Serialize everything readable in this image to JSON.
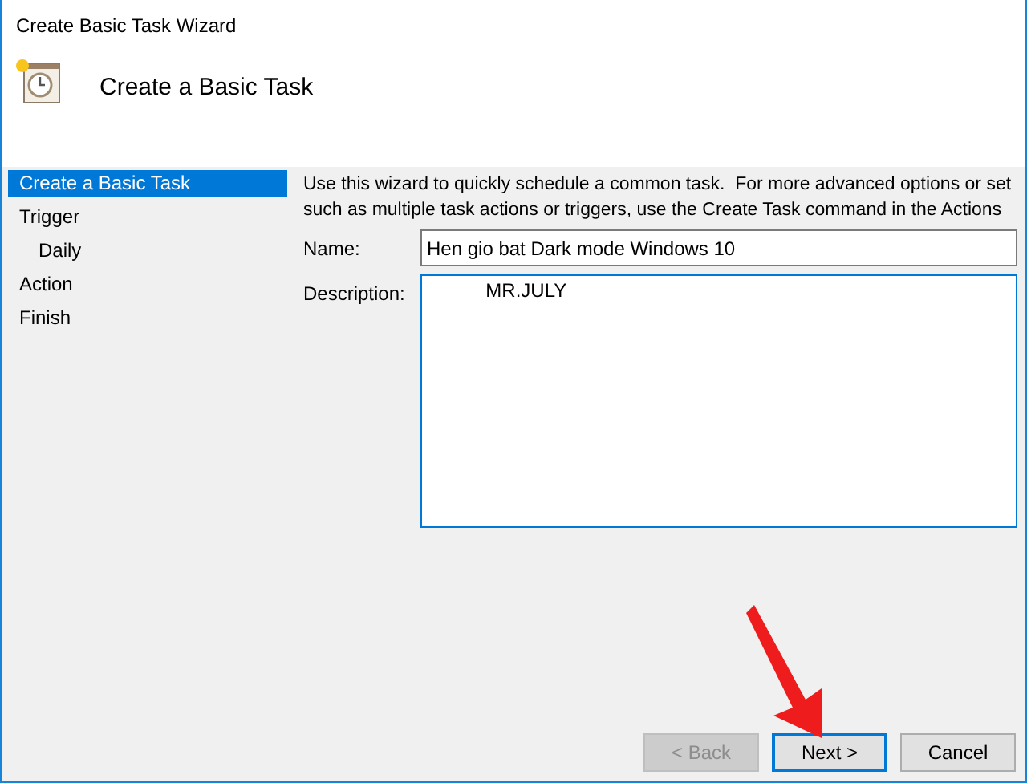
{
  "window": {
    "title": "Create Basic Task Wizard"
  },
  "header": {
    "title": "Create a Basic Task"
  },
  "steps": [
    {
      "label": "Create a Basic Task",
      "selected": true
    },
    {
      "label": "Trigger",
      "selected": false,
      "children": [
        {
          "label": "Daily",
          "selected": false
        }
      ]
    },
    {
      "label": "Action",
      "selected": false
    },
    {
      "label": "Finish",
      "selected": false
    }
  ],
  "intro": [
    "Use this wizard to quickly schedule a common task.  For more advanced options or set",
    "such as multiple task actions or triggers, use the Create Task command in the Actions"
  ],
  "name_field": {
    "label": "Name:",
    "value": "Hen gio bat Dark mode Windows 10"
  },
  "description_field": {
    "label": "Description:",
    "value": "           MR.JULY"
  },
  "buttons": [
    {
      "label": "< Back",
      "disabled": true,
      "selected": false
    },
    {
      "label": "Next >",
      "disabled": false,
      "selected": true
    },
    {
      "label": "Cancel",
      "disabled": false,
      "selected": false
    }
  ]
}
